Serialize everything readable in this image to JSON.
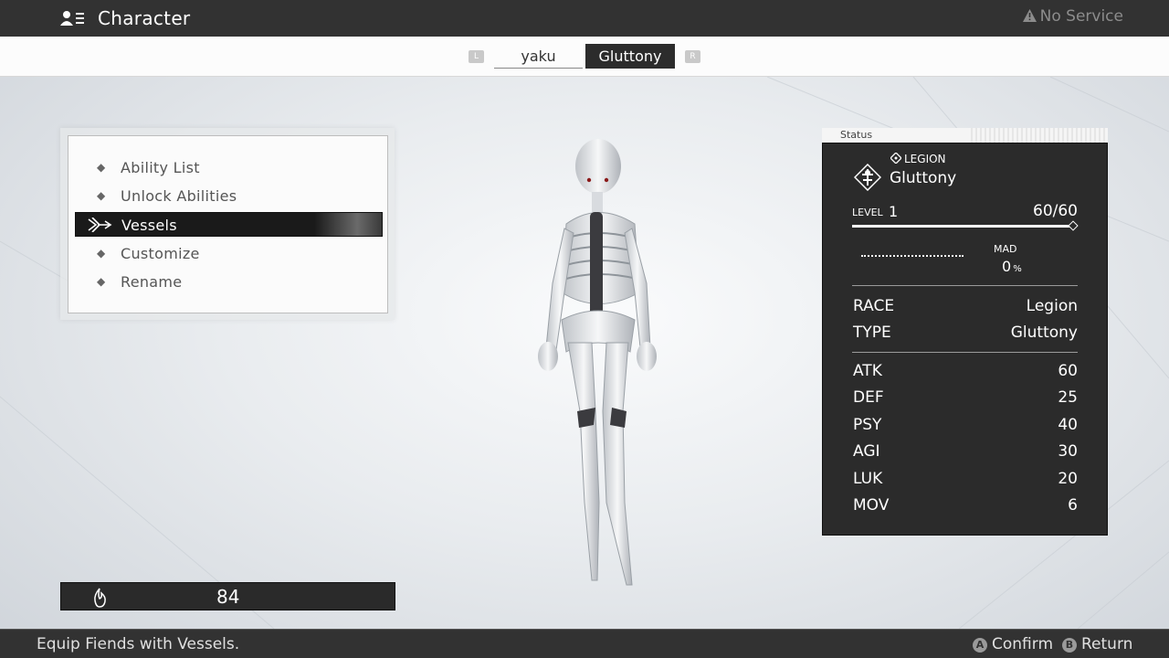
{
  "header": {
    "title": "Character",
    "title_icon": "party-members-icon",
    "network_status": "No Service",
    "network_icon": "warning-triangle-icon"
  },
  "tabs": {
    "left_shoulder": "L",
    "right_shoulder": "R",
    "items": [
      {
        "label": "yaku",
        "selected": false
      },
      {
        "label": "Gluttony",
        "selected": true
      }
    ]
  },
  "menu": {
    "items": [
      {
        "label": "Ability List",
        "selected": false
      },
      {
        "label": "Unlock Abilities",
        "selected": false
      },
      {
        "label": "Vessels",
        "selected": true
      },
      {
        "label": "Customize",
        "selected": false
      },
      {
        "label": "Rename",
        "selected": false
      }
    ]
  },
  "currency": {
    "icon": "flame-icon",
    "amount": "84"
  },
  "status": {
    "header": "Status",
    "race_label": "LEGION",
    "name": "Gluttony",
    "level_label": "LEVEL",
    "level": "1",
    "hp": "60/60",
    "hp_fraction": 1.0,
    "mad_label": "MAD",
    "mad_value": "0",
    "mad_unit": "%",
    "mad_fraction": 0.0,
    "race": {
      "label": "RACE",
      "value": "Legion"
    },
    "type": {
      "label": "TYPE",
      "value": "Gluttony"
    },
    "stats": [
      {
        "label": "ATK",
        "value": "60"
      },
      {
        "label": "DEF",
        "value": "25"
      },
      {
        "label": "PSY",
        "value": "40"
      },
      {
        "label": "AGI",
        "value": "30"
      },
      {
        "label": "LUK",
        "value": "20"
      },
      {
        "label": "MOV",
        "value": "6"
      }
    ]
  },
  "footer": {
    "help_text": "Equip Fiends with Vessels.",
    "confirm_button": "A",
    "confirm_label": "Confirm",
    "return_button": "B",
    "return_label": "Return"
  }
}
